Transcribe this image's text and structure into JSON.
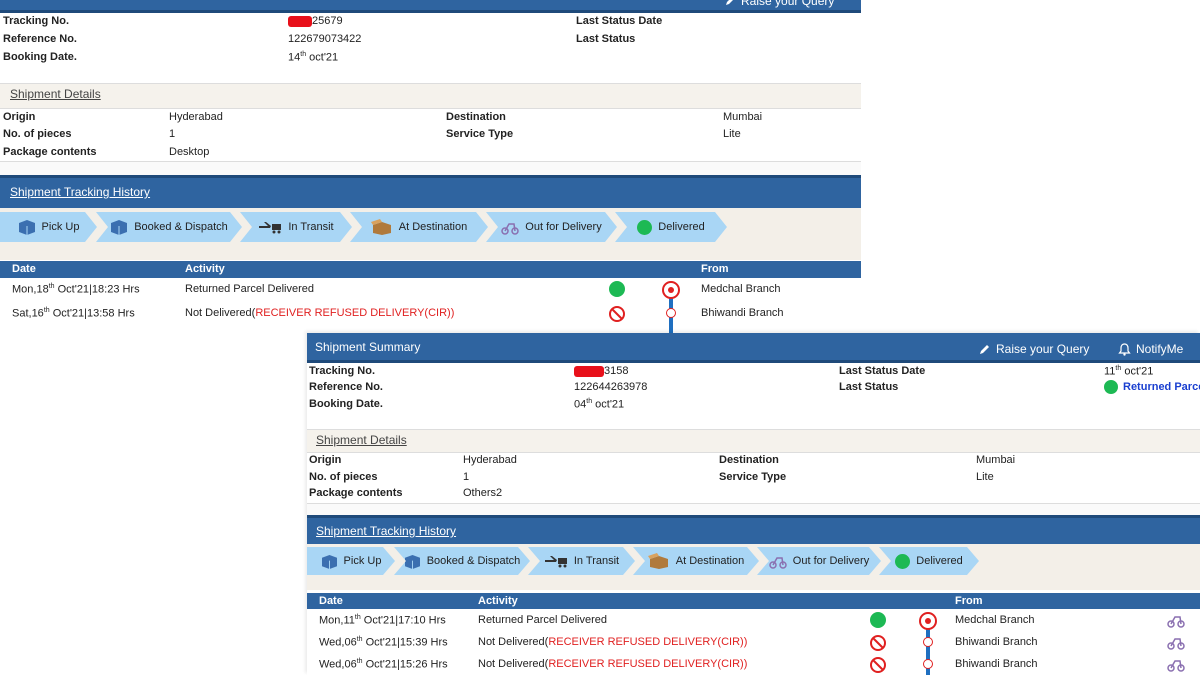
{
  "panel1": {
    "raise_query": "Raise your Query",
    "tracking_label": "Tracking No.",
    "tracking_value": "25679",
    "reference_label": "Reference No.",
    "reference_value": "122679073422",
    "booking_label": "Booking Date.",
    "booking_day": "14",
    "booking_sup": "th",
    "booking_rest": " oct'21",
    "last_status_date_label": "Last Status Date",
    "last_status_label": "Last Status",
    "shipment_details": "Shipment Details",
    "origin_label": "Origin",
    "origin_value": "Hyderabad",
    "pieces_label": "No. of pieces",
    "pieces_value": "1",
    "contents_label": "Package contents",
    "contents_value": "Desktop",
    "destination_label": "Destination",
    "destination_value": "Mumbai",
    "service_label": "Service Type",
    "service_value": "Lite",
    "history_title": "Shipment Tracking History",
    "steps": [
      "Pick Up",
      "Booked & Dispatch",
      "In Transit",
      "At Destination",
      "Out for Delivery",
      "Delivered"
    ],
    "col_date": "Date",
    "col_activity": "Activity",
    "col_from": "From",
    "rows": [
      {
        "date_pre": "Mon,18",
        "date_sup": "th",
        "date_post": " Oct'21|18:23 Hrs",
        "activity": "Returned Parcel Delivered",
        "activity_red": "",
        "from": "Medchal Branch"
      },
      {
        "date_pre": "Sat,16",
        "date_sup": "th",
        "date_post": " Oct'21|13:58 Hrs",
        "activity": "Not Delivered(",
        "activity_red": "RECEIVER REFUSED DELIVERY(CIR))",
        "from": "Bhiwandi Branch"
      }
    ]
  },
  "panel2": {
    "title": "Shipment Summary",
    "raise_query": "Raise your Query",
    "notify": "NotifyMe",
    "tracking_label": "Tracking No.",
    "tracking_value": "3158",
    "reference_label": "Reference No.",
    "reference_value": "122644263978",
    "booking_label": "Booking Date.",
    "booking_day": "04",
    "booking_sup": "th",
    "booking_rest": " oct'21",
    "last_status_date_label": "Last Status Date",
    "last_status_date_day": "11",
    "last_status_date_sup": "th",
    "last_status_date_rest": " oct'21",
    "last_status_label": "Last Status",
    "last_status_value": "Returned Parcel",
    "shipment_details": "Shipment Details",
    "origin_label": "Origin",
    "origin_value": "Hyderabad",
    "pieces_label": "No. of pieces",
    "pieces_value": "1",
    "contents_label": "Package contents",
    "contents_value": "Others2",
    "destination_label": "Destination",
    "destination_value": "Mumbai",
    "service_label": "Service Type",
    "service_value": "Lite",
    "history_title": "Shipment Tracking History",
    "steps": [
      "Pick Up",
      "Booked & Dispatch",
      "In Transit",
      "At Destination",
      "Out for Delivery",
      "Delivered"
    ],
    "col_date": "Date",
    "col_activity": "Activity",
    "col_from": "From",
    "rows": [
      {
        "date_pre": "Mon,11",
        "date_sup": "th",
        "date_post": " Oct'21|17:10 Hrs",
        "activity": "Returned Parcel Delivered",
        "activity_red": "",
        "from": "Medchal Branch"
      },
      {
        "date_pre": "Wed,06",
        "date_sup": "th",
        "date_post": " Oct'21|15:39 Hrs",
        "activity": "Not Delivered(",
        "activity_red": "RECEIVER REFUSED DELIVERY(CIR))",
        "from": "Bhiwandi Branch"
      },
      {
        "date_pre": "Wed,06",
        "date_sup": "th",
        "date_post": " Oct'21|15:26 Hrs",
        "activity": "Not Delivered(",
        "activity_red": "RECEIVER REFUSED DELIVERY(CIR))",
        "from": "Bhiwandi Branch"
      }
    ]
  },
  "colors": {
    "header": "#2f64a0",
    "step": "#a9d6f5",
    "delivered": "#1db954",
    "refused": "#e02020",
    "timeline": "#1f6fc0"
  },
  "icons": {
    "query": "pencil-icon",
    "notify": "bell-icon",
    "pickup": "box-icon",
    "booked": "box-icon",
    "transit": "plane-truck-icon",
    "destination": "open-box-icon",
    "out": "scooter-icon",
    "delivered": "green-dot-icon"
  }
}
